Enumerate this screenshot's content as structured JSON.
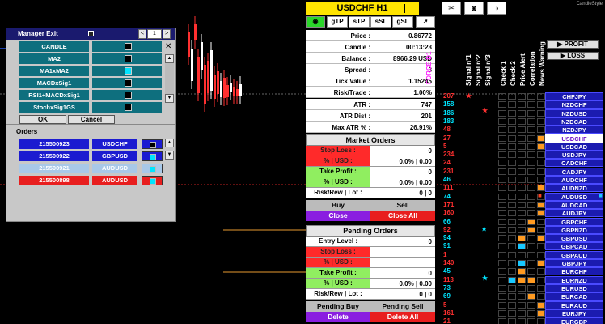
{
  "brand": "CandleStyle",
  "manager": {
    "title": "Manager Exit",
    "page": "1",
    "prev_label": "<",
    "next_label": ">",
    "close_icon": "x-icon",
    "filters": [
      {
        "name": "CANDLE",
        "on": false
      },
      {
        "name": "MA2",
        "on": false
      },
      {
        "name": "MA1xMA2",
        "on": true
      },
      {
        "name": "MACDxSig1",
        "on": false
      },
      {
        "name": "RSI1+MACDxSig1",
        "on": false
      },
      {
        "name": "StochxSig1GS",
        "on": false
      }
    ],
    "ok_label": "OK",
    "cancel_label": "Cancel",
    "orders_label": "Orders",
    "orders": [
      {
        "id": "215500923",
        "symbol": "USDCHF",
        "color": "#1b1bd0",
        "on": false
      },
      {
        "id": "215500922",
        "symbol": "GBPUSD",
        "color": "#1b1bd0",
        "on": true
      },
      {
        "id": "215500921",
        "symbol": "AUDUSD",
        "color": "#a8c8e8",
        "on": true
      },
      {
        "id": "215500898",
        "symbol": "AUDUSD",
        "color": "#e81e1e",
        "on": true
      }
    ]
  },
  "trade": {
    "symbol": "USDCHF H1",
    "timeframe": "H1",
    "tools": [
      "gTP",
      "sTP",
      "sSL",
      "gSL"
    ],
    "info": [
      {
        "label": "Price :",
        "value": "0.86772"
      },
      {
        "label": "Candle :",
        "value": "00:13:23"
      },
      {
        "label": "Balance :",
        "value": "8966.29 USD"
      },
      {
        "label": "Spread :",
        "value": "3"
      },
      {
        "label": "Tick Value :",
        "value": "1.15245"
      },
      {
        "label": "Risk/Trade :",
        "value": "1.00%"
      }
    ],
    "atr": [
      {
        "label": "ATR :",
        "value": "747"
      },
      {
        "label": "ATR Dist :",
        "value": "201"
      },
      {
        "label": "Max ATR % :",
        "value": "26.91%"
      }
    ],
    "market": {
      "title": "Market Orders",
      "stop_loss": {
        "label": "Stop Loss :",
        "value": "0"
      },
      "sl_usd": {
        "label": "% | USD :",
        "value": "0.0% | 0.00"
      },
      "take_profit": {
        "label": "Take Profit :",
        "value": "0"
      },
      "tp_usd": {
        "label": "% | USD :",
        "value": "0.0% | 0.00"
      },
      "rr": {
        "label": "Risk/Rew | Lot :",
        "value": "0 | 0"
      },
      "buy": "Buy",
      "sell": "Sell",
      "close": "Close",
      "close_all": "Close All"
    },
    "pending": {
      "title": "Pending Orders",
      "entry": {
        "label": "Entry Level :",
        "value": "0"
      },
      "stop_loss": {
        "label": "Stop Loss :",
        "value": ""
      },
      "sl_usd": {
        "label": "% | USD :",
        "value": ""
      },
      "take_profit": {
        "label": "Take Profit :",
        "value": "0"
      },
      "tp_usd": {
        "label": "% | USD :",
        "value": "0.0% | 0.00"
      },
      "rr": {
        "label": "Risk/Rew | Lot :",
        "value": "0 | 0"
      },
      "buy": "Pending Buy",
      "sell": "Pending Sell",
      "delete": "Delete",
      "delete_all": "Delete All"
    }
  },
  "signals": {
    "headers": [
      "FORCE D1",
      "Signal n°1",
      "Signal n°2",
      "Signal n°3",
      "Check 1",
      "Check 2",
      "Price Alert",
      "Correlation",
      "News Warning"
    ],
    "profit_label": "PROFIT",
    "loss_label": "LOSS",
    "rows": [
      {
        "force": "207",
        "fc": "#ff3030",
        "pair": "CHFJPY"
      },
      {
        "force": "158",
        "fc": "#00e5ff",
        "pair": "NZDCHF"
      },
      {
        "force": "186",
        "fc": "#00e5ff",
        "pair": "NZDUSD"
      },
      {
        "force": "183",
        "fc": "#00e5ff",
        "pair": "NZDCAD"
      },
      {
        "force": "48",
        "fc": "#ff3030",
        "pair": "NZDJPY"
      },
      {
        "force": "27",
        "fc": "#ff3030",
        "pair": "USDCHF",
        "hl": true
      },
      {
        "force": "5",
        "fc": "#ff3030",
        "pair": "USDCAD"
      },
      {
        "force": "234",
        "fc": "#ff3030",
        "pair": "USDJPY"
      },
      {
        "force": "24",
        "fc": "#ff3030",
        "pair": "CADCHF"
      },
      {
        "force": "231",
        "fc": "#ff3030",
        "pair": "CADJPY"
      },
      {
        "force": "46",
        "fc": "#00e5ff",
        "pair": "AUDCHF"
      },
      {
        "force": "111",
        "fc": "#ff3030",
        "pair": "AUDNZD"
      },
      {
        "force": "74",
        "fc": "#00e5ff",
        "pair": "AUDUSD"
      },
      {
        "force": "171",
        "fc": "#ff3030",
        "pair": "AUDCAD"
      },
      {
        "force": "160",
        "fc": "#ff3030",
        "pair": "AUDJPY"
      },
      {
        "force": "66",
        "fc": "#00e5ff",
        "pair": "GBPCHF"
      },
      {
        "force": "92",
        "fc": "#ff3030",
        "pair": "GBPNZD"
      },
      {
        "force": "94",
        "fc": "#00e5ff",
        "pair": "GBPUSD"
      },
      {
        "force": "91",
        "fc": "#00e5ff",
        "pair": "GBPCAD"
      },
      {
        "force": "1",
        "fc": "#ff3030",
        "pair": "GBPAUD"
      },
      {
        "force": "140",
        "fc": "#ff3030",
        "pair": "GBPJPY"
      },
      {
        "force": "45",
        "fc": "#00e5ff",
        "pair": "EURCHF"
      },
      {
        "force": "113",
        "fc": "#ff3030",
        "pair": "EURNZD"
      },
      {
        "force": "73",
        "fc": "#00e5ff",
        "pair": "EURUSD"
      },
      {
        "force": "69",
        "fc": "#00e5ff",
        "pair": "EURCAD"
      },
      {
        "force": "5",
        "fc": "#ff3030",
        "pair": "EURAUD"
      },
      {
        "force": "161",
        "fc": "#ff3030",
        "pair": "EURJPY"
      },
      {
        "force": "21",
        "fc": "#ff3030",
        "pair": "EURGBP"
      }
    ]
  }
}
